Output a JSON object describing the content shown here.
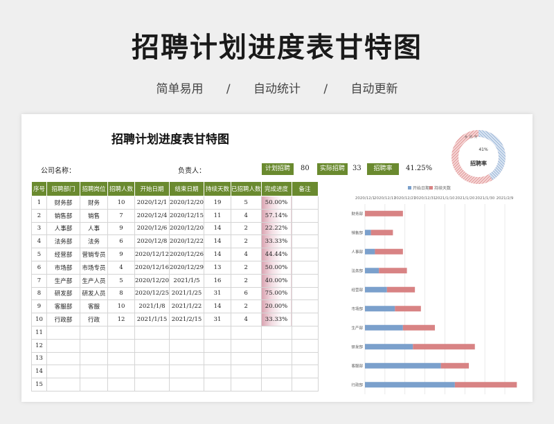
{
  "poster": {
    "title": "招聘计划进度表甘特图",
    "subtitle": [
      "简单易用",
      "/",
      "自动统计",
      "/",
      "自动更新"
    ]
  },
  "sheet": {
    "title": "招聘计划进度表甘特图",
    "company_label": "公司名称：",
    "owner_label": "负责人：",
    "plan_label": "计划招聘",
    "plan_value": "80",
    "actual_label": "实际招聘",
    "actual_value": "33",
    "rate_label": "招聘率",
    "rate_value": "41.25%",
    "donut": {
      "percent_text": "41%",
      "center_label": "招聘率",
      "percent": 41.25,
      "legend": [
        "未",
        "招",
        "完"
      ]
    }
  },
  "table": {
    "headers": [
      "序号",
      "招聘部门",
      "招聘岗位",
      "招聘人数",
      "开始日期",
      "结束日期",
      "持续天数",
      "已招聘人数",
      "完成进度",
      "备注"
    ],
    "rows": [
      [
        "1",
        "财务部",
        "财务",
        "10",
        "2020/12/1",
        "2020/12/20",
        "19",
        "5",
        "50.00%",
        ""
      ],
      [
        "2",
        "销售部",
        "销售",
        "7",
        "2020/12/4",
        "2020/12/15",
        "11",
        "4",
        "57.14%",
        ""
      ],
      [
        "3",
        "人事部",
        "人事",
        "9",
        "2020/12/6",
        "2020/12/20",
        "14",
        "2",
        "22.22%",
        ""
      ],
      [
        "4",
        "法务部",
        "法务",
        "6",
        "2020/12/8",
        "2020/12/22",
        "14",
        "2",
        "33.33%",
        ""
      ],
      [
        "5",
        "经营部",
        "营销专员",
        "9",
        "2020/12/12",
        "2020/12/26",
        "14",
        "4",
        "44.44%",
        ""
      ],
      [
        "6",
        "市场部",
        "市场专员",
        "4",
        "2020/12/16",
        "2020/12/29",
        "13",
        "2",
        "50.00%",
        ""
      ],
      [
        "7",
        "生产部",
        "生产人员",
        "5",
        "2020/12/20",
        "2021/1/5",
        "16",
        "2",
        "40.00%",
        ""
      ],
      [
        "8",
        "研发部",
        "研发人员",
        "8",
        "2020/12/25",
        "2021/1/25",
        "31",
        "6",
        "75.00%",
        ""
      ],
      [
        "9",
        "客服部",
        "客服",
        "10",
        "2021/1/8",
        "2021/1/22",
        "14",
        "2",
        "20.00%",
        ""
      ],
      [
        "10",
        "行政部",
        "行政",
        "12",
        "2021/1/15",
        "2021/2/15",
        "31",
        "4",
        "33.33%",
        ""
      ],
      [
        "11",
        "",
        "",
        "",
        "",
        "",
        "",
        "",
        "",
        ""
      ],
      [
        "12",
        "",
        "",
        "",
        "",
        "",
        "",
        "",
        "",
        ""
      ],
      [
        "13",
        "",
        "",
        "",
        "",
        "",
        "",
        "",
        "",
        ""
      ],
      [
        "14",
        "",
        "",
        "",
        "",
        "",
        "",
        "",
        "",
        ""
      ],
      [
        "15",
        "",
        "",
        "",
        "",
        "",
        "",
        "",
        "",
        ""
      ]
    ]
  },
  "chart_data": {
    "type": "bar",
    "orientation": "horizontal-stacked",
    "legend": [
      "开始日期",
      "持续天数"
    ],
    "legend_placement": "top",
    "x_tick_labels": [
      "2020/12/1",
      "2020/12/11",
      "2020/12/21",
      "2020/12/31",
      "2021/1/10",
      "2021/1/20",
      "2021/1/30",
      "2021/2/9"
    ],
    "categories": [
      "财务部",
      "销售部",
      "人事部",
      "法务部",
      "经营部",
      "市场部",
      "生产部",
      "研发部",
      "客服部",
      "行政部"
    ],
    "series": [
      {
        "name": "开始日期",
        "values": [
          "2020/12/1",
          "2020/12/4",
          "2020/12/6",
          "2020/12/8",
          "2020/12/12",
          "2020/12/16",
          "2020/12/20",
          "2020/12/25",
          "2021/1/8",
          "2021/1/15"
        ],
        "color": "#7ba0cc"
      },
      {
        "name": "持续天数",
        "values": [
          19,
          11,
          14,
          14,
          14,
          13,
          16,
          31,
          14,
          31
        ],
        "color": "#d88384"
      }
    ],
    "xlim": [
      "2020/12/1",
      "2021/2/18"
    ],
    "grid": true
  }
}
